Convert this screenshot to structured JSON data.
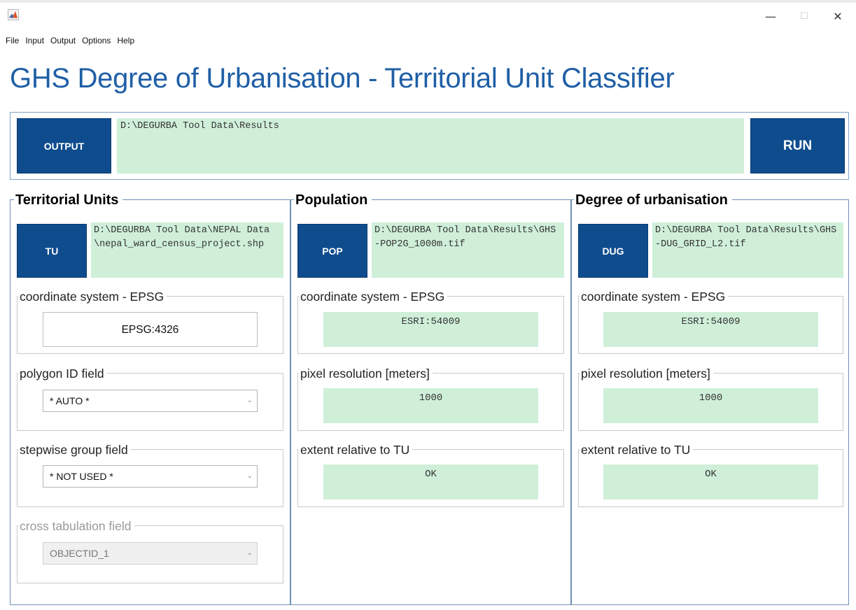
{
  "window": {
    "minimize_glyph": "—",
    "maximize_glyph": "☐",
    "close_glyph": "✕"
  },
  "menu": [
    "File",
    "Input",
    "Output",
    "Options",
    "Help"
  ],
  "app_title": "GHS Degree of Urbanisation - Territorial Unit Classifier",
  "output": {
    "button_label": "OUTPUT",
    "path": "D:\\DEGURBA Tool Data\\Results",
    "run_label": "RUN"
  },
  "territorial_units": {
    "title": "Territorial Units",
    "button_label": "TU",
    "path": "D:\\DEGURBA Tool Data\\NEPAL Data\\nepal_ward_census_project.shp",
    "crs_label": "coordinate system - EPSG",
    "crs_value": "EPSG:4326",
    "polygon_label": "polygon ID field",
    "polygon_value": "* AUTO *",
    "stepwise_label": "stepwise group field",
    "stepwise_value": "* NOT USED *",
    "cross_label": "cross tabulation field",
    "cross_value": "OBJECTID_1"
  },
  "population": {
    "title": "Population",
    "button_label": "POP",
    "path": "D:\\DEGURBA Tool Data\\Results\\GHS-POP2G_1000m.tif",
    "crs_label": "coordinate system - EPSG",
    "crs_value": "ESRI:54009",
    "res_label": "pixel resolution [meters]",
    "res_value": "1000",
    "extent_label": "extent relative to TU",
    "extent_value": "OK"
  },
  "degurba": {
    "title": "Degree of urbanisation",
    "button_label": "DUG",
    "path": "D:\\DEGURBA Tool Data\\Results\\GHS-DUG_GRID_L2.tif",
    "crs_label": "coordinate system - EPSG",
    "crs_value": "ESRI:54009",
    "res_label": "pixel resolution [meters]",
    "res_value": "1000",
    "extent_label": "extent relative to TU",
    "extent_value": "OK"
  },
  "colors": {
    "accent_blue": "#0f4c8e",
    "title_blue": "#1f5fa6",
    "field_green": "#cfefd9"
  },
  "icons": {
    "app": "matlab-logo-icon",
    "dropdown": "chevron-down-icon"
  }
}
